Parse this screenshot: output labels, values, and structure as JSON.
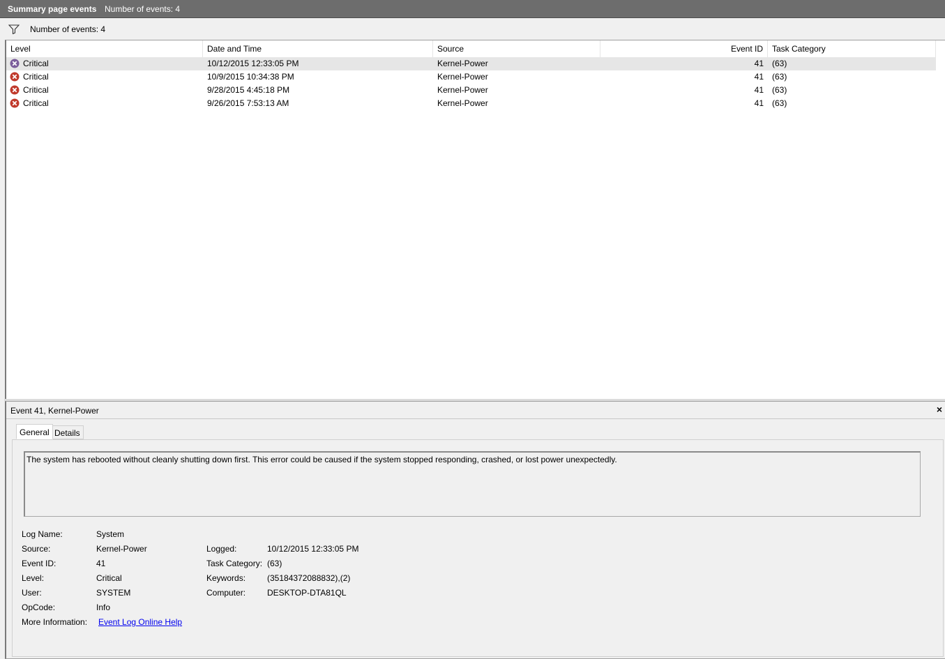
{
  "titlebar": {
    "title": "Summary page events",
    "count_text": "Number of events: 4"
  },
  "filter": {
    "icon": "filter-icon",
    "count_text": "Number of events: 4"
  },
  "grid": {
    "columns": [
      "Level",
      "Date and Time",
      "Source",
      "Event ID",
      "Task Category"
    ],
    "rows": [
      {
        "level": "Critical",
        "datetime": "10/12/2015 12:33:05 PM",
        "source": "Kernel-Power",
        "event_id": "41",
        "task_category": "(63)"
      },
      {
        "level": "Critical",
        "datetime": "10/9/2015 10:34:38 PM",
        "source": "Kernel-Power",
        "event_id": "41",
        "task_category": "(63)"
      },
      {
        "level": "Critical",
        "datetime": "9/28/2015 4:45:18 PM",
        "source": "Kernel-Power",
        "event_id": "41",
        "task_category": "(63)"
      },
      {
        "level": "Critical",
        "datetime": "9/26/2015 7:53:13 AM",
        "source": "Kernel-Power",
        "event_id": "41",
        "task_category": "(63)"
      }
    ]
  },
  "detail": {
    "title": "Event 41, Kernel-Power",
    "close_glyph": "×",
    "tabs": [
      "General",
      "Details"
    ],
    "description": "The system has rebooted without cleanly shutting down first. This error could be caused if the system stopped responding, crashed, or lost power unexpectedly.",
    "fields": {
      "log_name_label": "Log Name:",
      "log_name": "System",
      "source_label": "Source:",
      "source": "Kernel-Power",
      "event_id_label": "Event ID:",
      "event_id": "41",
      "level_label": "Level:",
      "level": "Critical",
      "user_label": "User:",
      "user": "SYSTEM",
      "opcode_label": "OpCode:",
      "opcode": "Info",
      "more_info_label": "More Information:",
      "more_info_link": "Event Log Online Help",
      "logged_label": "Logged:",
      "logged": "10/12/2015 12:33:05 PM",
      "task_category_label": "Task Category:",
      "task_category": "(63)",
      "keywords_label": "Keywords:",
      "keywords": "(35184372088832),(2)",
      "computer_label": "Computer:",
      "computer": "DESKTOP-DTA81QL"
    }
  },
  "colors": {
    "critical_icon": "#c0392b",
    "critical_icon_selected": "#7a5c9a",
    "link": "#0000ee",
    "titlebar_bg": "#6d6d6d"
  }
}
